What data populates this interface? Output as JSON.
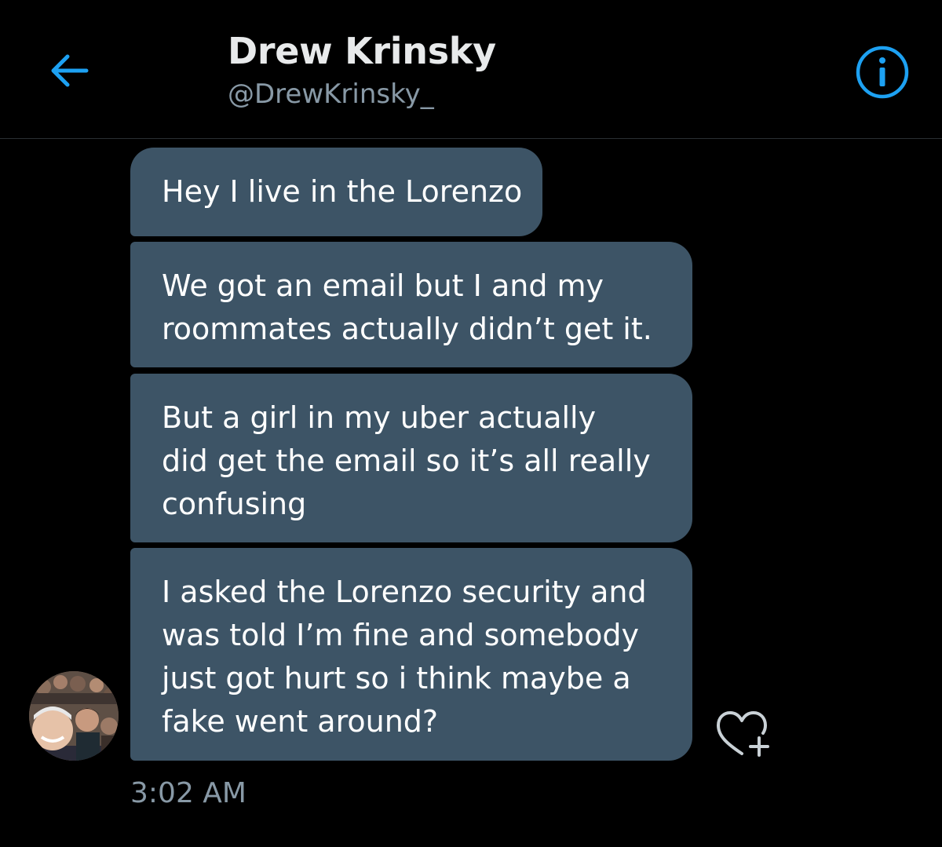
{
  "header": {
    "title": "Drew Krinsky",
    "handle": "@DrewKrinsky_",
    "back_icon": "back-arrow-icon",
    "info_icon": "info-icon",
    "accent_color": "#1da1f2"
  },
  "messages": [
    {
      "lines": [
        "Hey I live in the Lorenzo"
      ]
    },
    {
      "lines": [
        "We got an email but I and my",
        "roommates actually didn’t get it."
      ]
    },
    {
      "lines": [
        "But a girl in my uber actually",
        "did get the email so it’s all really",
        "confusing"
      ]
    },
    {
      "lines": [
        "I asked the Lorenzo security and",
        "was told I’m fine and somebody",
        "just got hurt so i think maybe a",
        "fake went around?"
      ]
    }
  ],
  "message_meta": {
    "timestamp": "3:02 AM",
    "like_icon": "heart-plus-icon"
  },
  "colors": {
    "background": "#000000",
    "bubble": "#3d5466",
    "muted_text": "#8899a6"
  }
}
